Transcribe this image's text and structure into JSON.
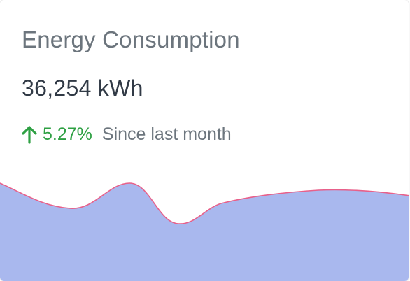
{
  "card": {
    "title": "Energy Consumption",
    "value": "36,254 kWh",
    "change": {
      "percent": "5.27%",
      "direction": "up",
      "since_label": "Since last month",
      "color": "#2ea043"
    }
  },
  "sparkline": {
    "fill_color": "#a9b8ee",
    "line_color": "#e8608a"
  },
  "icons": {
    "trend": "arrow-up-icon"
  }
}
